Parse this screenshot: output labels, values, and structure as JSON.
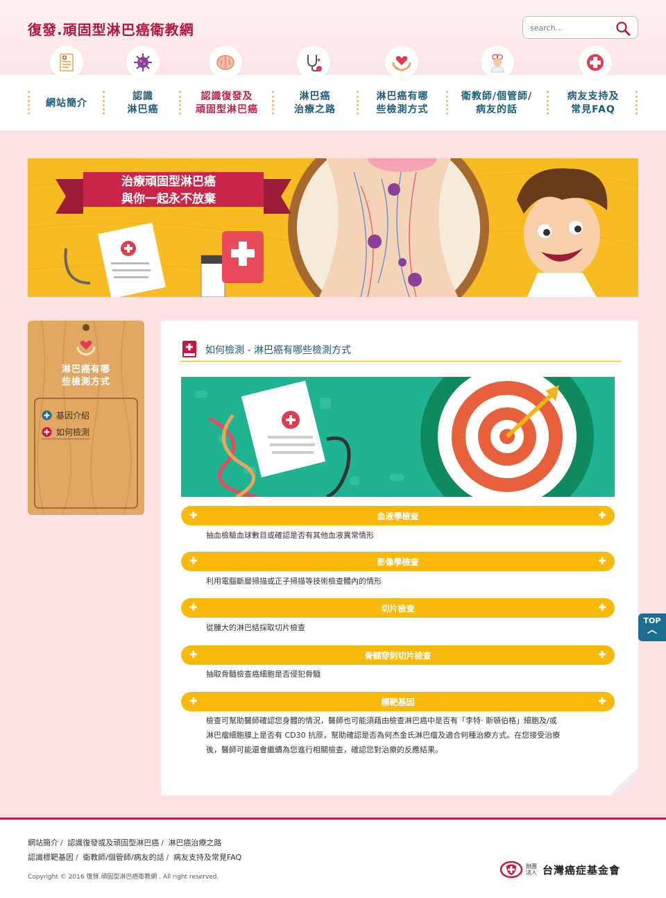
{
  "header": {
    "site_title": "復發.頑固型淋巴癌衛教網",
    "search_placeholder": "search..."
  },
  "nav": {
    "items": [
      {
        "label_line1": "網站簡介",
        "label_line2": "",
        "icon": "document-icon"
      },
      {
        "label_line1": "認識",
        "label_line2": "淋巴癌",
        "icon": "virus-icon"
      },
      {
        "label_line1": "認識復發及",
        "label_line2": "頑固型淋巴癌",
        "icon": "brain-icon"
      },
      {
        "label_line1": "淋巴癌",
        "label_line2": "治療之路",
        "icon": "stethoscope-icon"
      },
      {
        "label_line1": "淋巴癌有哪",
        "label_line2": "些檢測方式",
        "icon": "heart-hands-icon"
      },
      {
        "label_line1": "衛教師/個管師/",
        "label_line2": "病友的話",
        "icon": "nurse-icon"
      },
      {
        "label_line1": "病友支持及",
        "label_line2": "常見FAQ",
        "icon": "medical-cross-icon"
      }
    ]
  },
  "banner": {
    "line1": "治療頑固型淋巴癌",
    "line2": "與你一起永不放棄"
  },
  "sidebar": {
    "title_line1": "淋巴癌有哪",
    "title_line2": "些檢測方式",
    "links": [
      {
        "label": "基因介紹",
        "icon": "plus-circle-icon",
        "color": "#1c6d8f"
      },
      {
        "label": "如何檢測",
        "icon": "plus-circle-icon",
        "color": "#c5173f"
      }
    ]
  },
  "content": {
    "title": "如何檢測 - 淋巴癌有哪些檢測方式",
    "sections": [
      {
        "title": "血液學檢查",
        "body": "抽血檢驗血球數目或確認是否有其他血液異常情形"
      },
      {
        "title": "影像學檢查",
        "body": "利用電腦斷層掃描或正子掃描等技術檢查體內的情形"
      },
      {
        "title": "切片檢查",
        "body": "從腫大的淋巴結採取切片檢查"
      },
      {
        "title": "骨髓穿刺切片檢查",
        "body": "抽取骨髓檢查癌細胞是否侵犯骨髓"
      },
      {
        "title": "標靶基因",
        "body_lines": [
          "檢查可幫助醫師確認您身體的情況，醫師也可能須藉由檢查淋巴癌中是否有「李特‧ 斯頓伯格」細胞及/或",
          "淋巴瘤細胞膜上是否有 CD30 抗原，幫助確認是否為何杰金氏淋巴瘤及適合何種治療方式。在您接受治療",
          "後，醫師可能還會繼續為您進行相關檢查，確認您對治療的反應結果。"
        ]
      }
    ]
  },
  "top_button": {
    "label": "TOP"
  },
  "footer": {
    "links_row1": [
      "網站簡介",
      "認識復發或及頑固型淋巴癌",
      "淋巴癌治療之路"
    ],
    "links_row2": [
      "認識標靶基因",
      "衛教師/個管師/病友的話",
      "病友支持及常見FAQ"
    ],
    "copyright": "Copyright © 2016 復發.頑固型淋巴癌衛教網 . All right reserved.",
    "org_name": "台灣癌症基金會",
    "org_prefix": "財團法人"
  },
  "colors": {
    "brand": "#b5163c",
    "nav_text": "#1c5e78",
    "accent_yellow": "#f9b90b",
    "background": "#fde1e3"
  }
}
